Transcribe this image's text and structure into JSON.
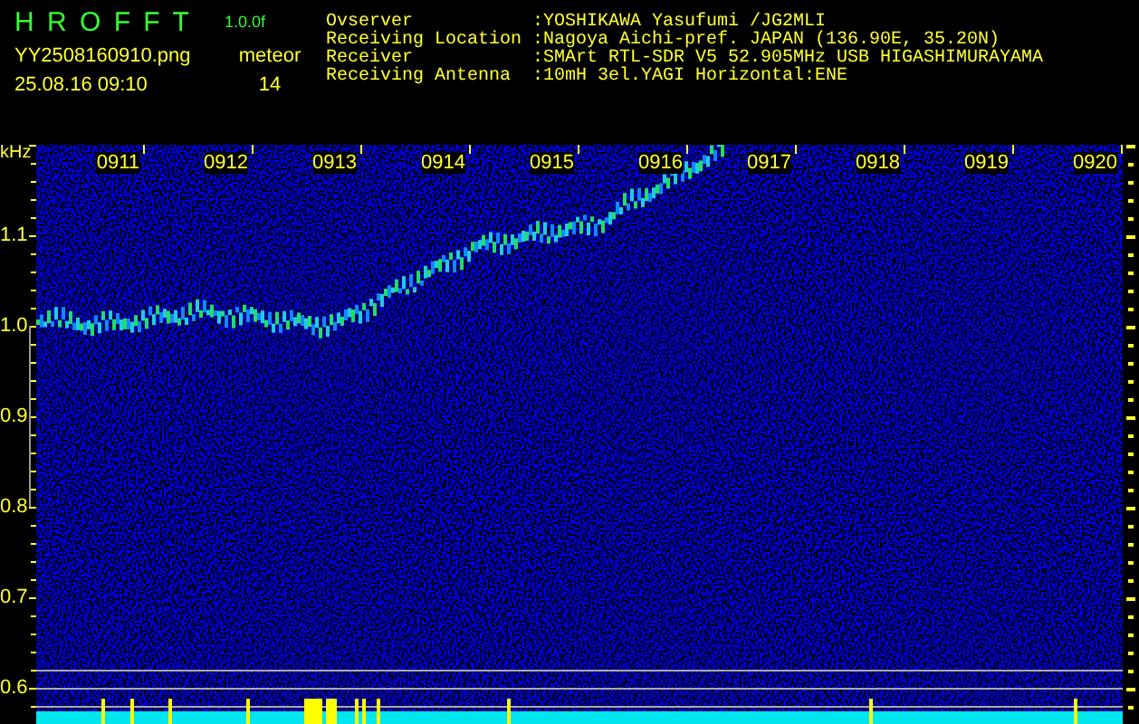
{
  "app": {
    "name": "H R O F F T",
    "version": "1.0.0f",
    "filename": "YY2508160910.png",
    "timestamp": "25.08.16 09:10",
    "mode": "meteor",
    "count": "14"
  },
  "station_info": [
    {
      "label": "Ovserver",
      "value": ":YOSHIKAWA Yasufumi /JG2MLI"
    },
    {
      "label": "Receiving Location",
      "value": ":Nagoya Aichi-pref. JAPAN (136.90E, 35.20N)"
    },
    {
      "label": "Receiver",
      "value": ":SMArt RTL-SDR V5 52.905MHz USB HIGASHIMURAYAMA"
    },
    {
      "label": "Receiving Antenna",
      "value": ":10mH 3el.YAGI Horizontal:ENE"
    }
  ],
  "spectrogram": {
    "unit": "kHz",
    "frequency_labels": [
      "1.1",
      "1.0",
      "0.9",
      "0.8",
      "0.7",
      "0.6"
    ],
    "time_labels": [
      "0911",
      "0912",
      "0913",
      "0914",
      "0915",
      "0916",
      "0917",
      "0918",
      "0919",
      "0920"
    ]
  }
}
